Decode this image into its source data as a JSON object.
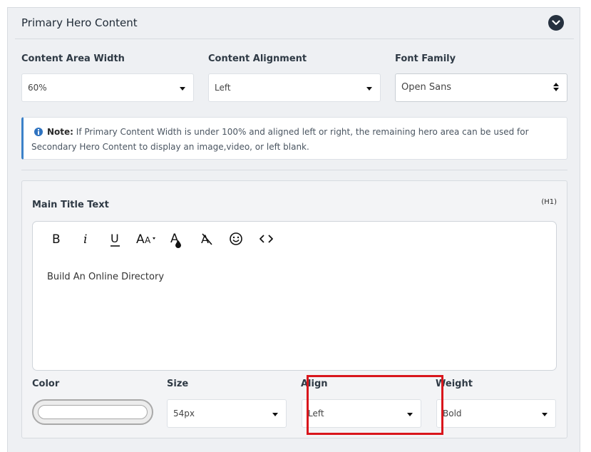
{
  "panel": {
    "title": "Primary Hero Content",
    "collapse_icon": "chevron-down-icon"
  },
  "layout_settings": {
    "content_area_width": {
      "label": "Content Area Width",
      "value": "60%"
    },
    "content_alignment": {
      "label": "Content Alignment",
      "value": "Left"
    },
    "font_family": {
      "label": "Font Family",
      "value": "Open Sans"
    }
  },
  "note": {
    "icon": "info-icon",
    "prefix": "Note:",
    "text": "If Primary Content Width is under 100% and aligned left or right, the remaining hero area can be used for Secondary Hero Content to display an image,video, or left blank."
  },
  "main_title": {
    "label": "Main Title Text",
    "tag": "(H1)",
    "toolbar": [
      {
        "name": "bold-icon",
        "glyph": "B"
      },
      {
        "name": "italic-icon",
        "glyph": "i"
      },
      {
        "name": "underline-icon",
        "glyph": "U"
      },
      {
        "name": "font-size-icon",
        "glyph": "AA"
      },
      {
        "name": "text-color-icon",
        "glyph": "A"
      },
      {
        "name": "clear-format-icon",
        "glyph": "A"
      },
      {
        "name": "emoji-icon",
        "glyph": "smile"
      },
      {
        "name": "code-view-icon",
        "glyph": "<>"
      }
    ],
    "content": "Build An Online Directory"
  },
  "style_settings": {
    "color": {
      "label": "Color",
      "value": ""
    },
    "size": {
      "label": "Size",
      "value": "54px"
    },
    "align": {
      "label": "Align",
      "value": "Left"
    },
    "weight": {
      "label": "Weight",
      "value": "Bold"
    }
  },
  "colors": {
    "highlight": "#d9161c",
    "note_accent": "#3c82c9",
    "info_icon": "#2f73c0",
    "collapse_button": "#26313f"
  }
}
